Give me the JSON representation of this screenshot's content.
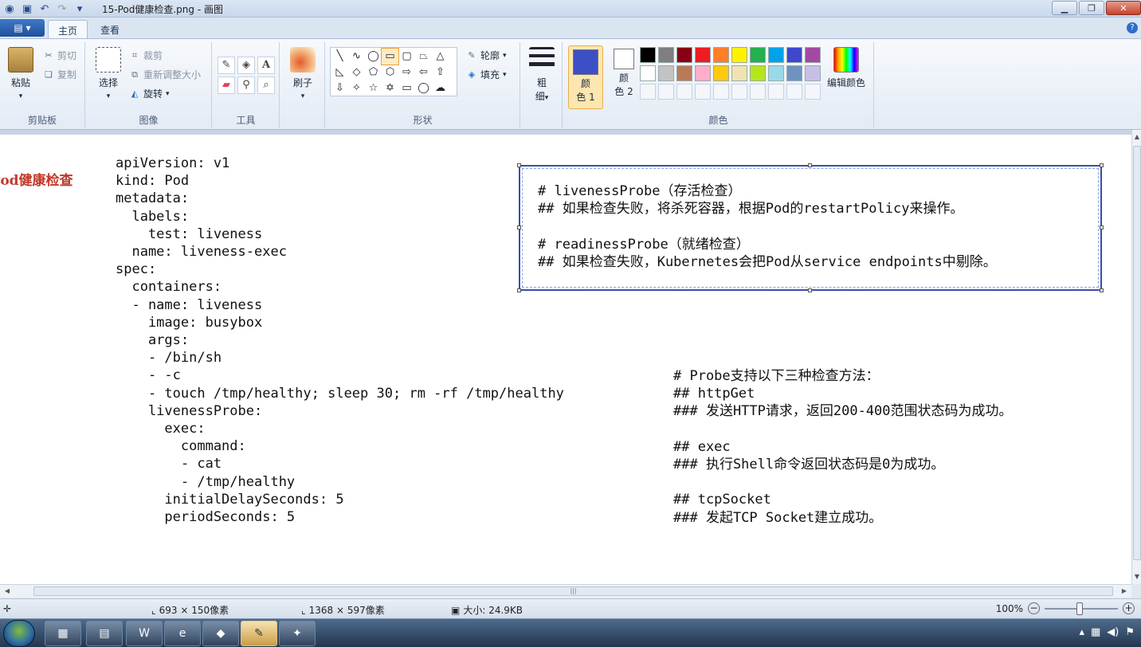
{
  "window": {
    "title": "15-Pod健康检查.png - 画图",
    "buttons": [
      "minimize-icon",
      "restore-icon",
      "close-icon"
    ]
  },
  "qat": [
    "save-icon",
    "undo-icon",
    "redo-icon",
    "dropdown-icon"
  ],
  "tabs": {
    "app_menu": "▤ ▾",
    "home": "主页",
    "view": "查看"
  },
  "ribbon": {
    "clipboard": {
      "paste": "粘贴",
      "cut": "剪切",
      "copy": "复制",
      "label": "剪贴板"
    },
    "image": {
      "select": "选择",
      "crop": "裁剪",
      "resize": "重新调整大小",
      "rotate": "旋转",
      "label": "图像"
    },
    "tools": {
      "label": "工具"
    },
    "brushes": {
      "label": "刷子"
    },
    "shapes": {
      "outline": "轮廓",
      "fill": "填充",
      "label": "形状"
    },
    "size": {
      "line1": "粗",
      "line2": "细"
    },
    "colors": {
      "color1_a": "颜",
      "color1_b": "色 1",
      "color2_a": "颜",
      "color2_b": "色 2",
      "edit": "编辑颜色",
      "label": "颜色",
      "color1_value": "#3d4fc4",
      "color2_value": "#ffffff",
      "palette_row1": [
        "#000000",
        "#7f7f7f",
        "#880015",
        "#ed1c24",
        "#ff7f27",
        "#fff200",
        "#22b14c",
        "#00a2e8",
        "#3f48cc",
        "#a349a4"
      ],
      "palette_row2": [
        "#ffffff",
        "#c3c3c3",
        "#b97a57",
        "#ffaec9",
        "#ffc90e",
        "#efe4b0",
        "#b5e61d",
        "#99d9ea",
        "#7092be",
        "#c8bfe7"
      ]
    }
  },
  "canvas": {
    "side_title": "Pod健康检查",
    "yaml": [
      "apiVersion: v1",
      "kind: Pod",
      "metadata:",
      "  labels:",
      "    test: liveness",
      "  name: liveness-exec",
      "spec:",
      "  containers:",
      "  - name: liveness",
      "    image: busybox",
      "    args:",
      "    - /bin/sh",
      "    - -c",
      "    - touch /tmp/healthy; sleep 30; rm -rf /tmp/healthy",
      "    livenessProbe:",
      "      exec:",
      "        command:",
      "        - cat",
      "        - /tmp/healthy",
      "      initialDelaySeconds: 5",
      "      periodSeconds: 5"
    ],
    "note_box": [
      "# livenessProbe（存活检查）",
      "## 如果检查失败，将杀死容器，根据Pod的restartPolicy来操作。",
      "",
      "# readinessProbe（就绪检查）",
      "## 如果检查失败，Kubernetes会把Pod从service endpoints中剔除。"
    ],
    "probes": [
      "# Probe支持以下三种检查方法：",
      "## httpGet",
      "### 发送HTTP请求，返回200-400范围状态码为成功。",
      "",
      "## exec",
      "### 执行Shell命令返回状态码是0为成功。",
      "",
      "## tcpSocket",
      "### 发起TCP Socket建立成功。"
    ]
  },
  "status": {
    "cursor_pos": "",
    "selection": "693 × 150像素",
    "image_size": "1368 × 597像素",
    "file_size": "大小: 24.9KB",
    "zoom": "100%"
  },
  "taskbar": {
    "items": [
      "explorer-icon",
      "folder-icon",
      "word-icon",
      "ie-icon",
      "app-icon",
      "paint-icon",
      "app2-icon"
    ]
  }
}
